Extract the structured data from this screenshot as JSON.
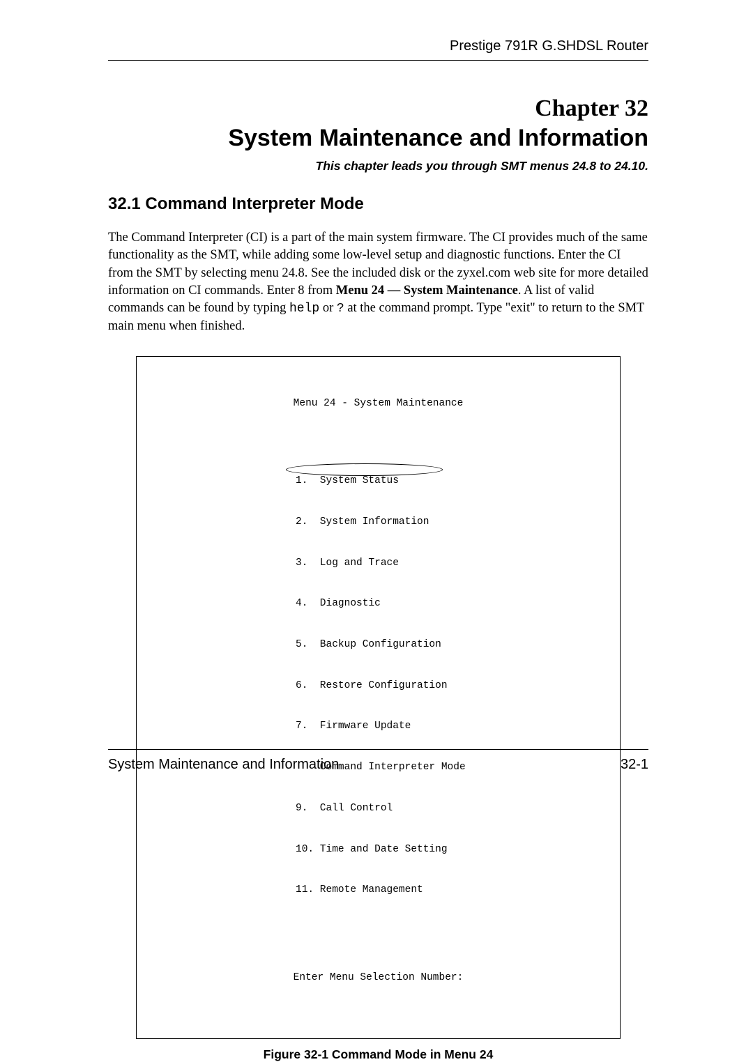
{
  "header": {
    "product": "Prestige 791R G.SHDSL Router"
  },
  "chapter": {
    "label": "Chapter 32",
    "title": "System Maintenance and Information",
    "subtitle": "This chapter leads you through SMT menus 24.8 to 24.10."
  },
  "section": {
    "heading": "32.1  Command Interpreter Mode"
  },
  "paragraph": {
    "part1": "The Command Interpreter (CI) is a part of the main system firmware. The CI provides much of the same functionality as the SMT, while adding some low-level setup and diagnostic functions. Enter the CI from the SMT by selecting menu 24.8. See the included disk or the zyxel.com web site for more detailed information on CI commands. Enter 8 from ",
    "bold": "Menu 24 — System Maintenance",
    "part2": ". A list of valid commands can be found by typing ",
    "code1": "help",
    "part3": " or ",
    "code2": "?",
    "part4": " at the command prompt. Type \"exit\" to return to the SMT main menu when finished."
  },
  "menu": {
    "title": "Menu 24 - System Maintenance",
    "items": [
      "1.  System Status",
      "2.  System Information",
      "3.  Log and Trace",
      "4.  Diagnostic",
      "5.  Backup Configuration",
      "6.  Restore Configuration",
      "7.  Firmware Update",
      "    Command Interpreter Mode",
      "9.  Call Control",
      "10. Time and Date Setting",
      "11. Remote Management"
    ],
    "prompt": "Enter Menu Selection Number:"
  },
  "figure_caption": "Figure 32-1 Command Mode in Menu 24",
  "footer": {
    "left": "System Maintenance and Information",
    "right": "32-1"
  }
}
